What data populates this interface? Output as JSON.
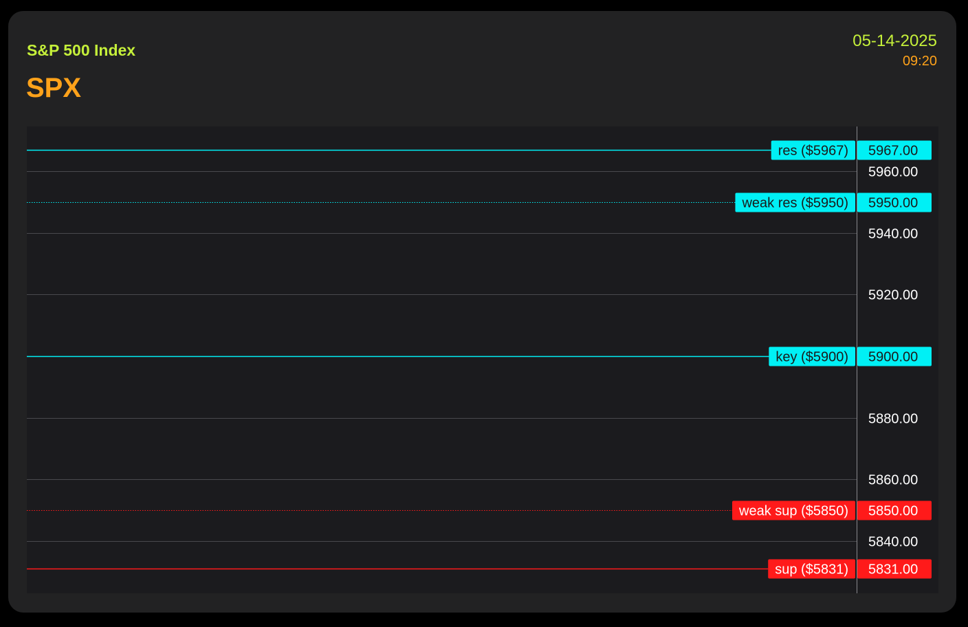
{
  "header": {
    "subtitle": "S&P 500 Index",
    "ticker": "SPX",
    "date": "05-14-2025",
    "time": "09:20"
  },
  "colors": {
    "background": "#1b1b1e",
    "card": "#222223",
    "subtitle": "#c5f03a",
    "ticker": "#ffa21a",
    "resistance": "#00f0f5",
    "support": "#ff1a1a",
    "grid": "#4a4a4e",
    "tick_text": "#ffffff"
  },
  "chart_data": {
    "type": "line",
    "y_axis_position": "right",
    "ylim": [
      5823,
      5974.5
    ],
    "y_ticks": [
      5840,
      5860,
      5880,
      5920,
      5940,
      5960
    ],
    "y_tick_labels": [
      "5840.00",
      "5860.00",
      "5880.00",
      "5920.00",
      "5940.00",
      "5960.00"
    ],
    "grid": true,
    "levels": [
      {
        "label": "res ($5967)",
        "value": 5967,
        "value_label": "5967.00",
        "style": "solid",
        "color": "#00f0f5",
        "text_color": "#1a1a1a"
      },
      {
        "label": "weak res ($5950)",
        "value": 5950,
        "value_label": "5950.00",
        "style": "dotted",
        "color": "#00f0f5",
        "text_color": "#1a1a1a"
      },
      {
        "label": "key ($5900)",
        "value": 5900,
        "value_label": "5900.00",
        "style": "solid",
        "color": "#00f0f5",
        "text_color": "#1a1a1a"
      },
      {
        "label": "weak sup ($5850)",
        "value": 5850,
        "value_label": "5850.00",
        "style": "dotted",
        "color": "#ff1a1a",
        "text_color": "#ffffff"
      },
      {
        "label": "sup ($5831)",
        "value": 5831,
        "value_label": "5831.00",
        "style": "solid",
        "color": "#ff1a1a",
        "text_color": "#ffffff"
      }
    ]
  }
}
